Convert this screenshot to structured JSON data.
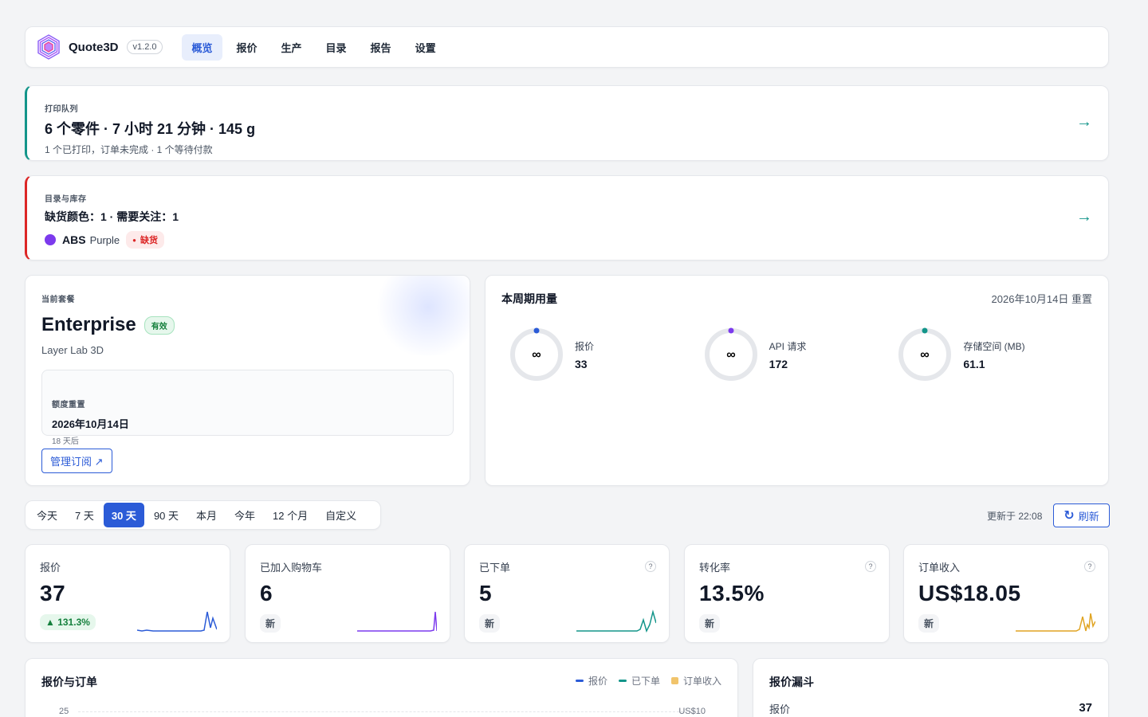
{
  "colors": {
    "accent": "#2b5bd7",
    "teal": "#13958a",
    "danger": "#dc2626",
    "purple": "#7c3aed",
    "gold": "#e0a422"
  },
  "nav": {
    "brand": "Quote3D",
    "version": "v1.2.0",
    "tabs": [
      "概览",
      "报价",
      "生产",
      "目录",
      "报告",
      "设置"
    ],
    "active_tab": "概览"
  },
  "queue": {
    "eyebrow": "打印队列",
    "headline": "6 个零件 · 7 小时 21 分钟 · 145 g",
    "sub": "1 个已打印，订单未完成 · 1 个等待付款",
    "arrow": "→"
  },
  "inventory": {
    "eyebrow": "目录与库存",
    "headline": "缺货颜色：1 · 需要关注：1",
    "material": "ABS",
    "color": "Purple",
    "status": "缺货",
    "arrow": "→"
  },
  "plan": {
    "eyebrow": "当前套餐",
    "name": "Enterprise",
    "badge": "有效",
    "org": "Layer Lab 3D",
    "reset_label": "额度重置",
    "reset_date": "2026年10月14日",
    "reset_days": "18 天后",
    "manage": "管理订阅 ↗"
  },
  "usage": {
    "title": "本周期用量",
    "reset_note": "2026年10月14日 重置",
    "meters": [
      {
        "label": "报价",
        "value": "33",
        "limit": "∞",
        "color": "#2b5bd7"
      },
      {
        "label": "API 请求",
        "value": "172",
        "limit": "∞",
        "color": "#7c3aed"
      },
      {
        "label": "存储空间 (MB)",
        "value": "61.1",
        "limit": "∞",
        "color": "#13958a"
      }
    ]
  },
  "ranges": {
    "items": [
      "今天",
      "7 天",
      "30 天",
      "90 天",
      "本月",
      "今年",
      "12 个月",
      "自定义"
    ],
    "active": "30 天",
    "updated": "更新于 22:08",
    "refresh": "刷新"
  },
  "kpis": [
    {
      "label": "报价",
      "value": "37",
      "tag": "▲ 131.3%",
      "tag_up": true,
      "help": "",
      "color": "#2b5bd7"
    },
    {
      "label": "已加入购物车",
      "value": "6",
      "tag": "新",
      "tag_up": false,
      "help": "",
      "color": "#7c3aed"
    },
    {
      "label": "已下单",
      "value": "5",
      "tag": "新",
      "tag_up": false,
      "help": "?",
      "color": "#13958a"
    },
    {
      "label": "转化率",
      "value": "13.5%",
      "tag": "新",
      "tag_up": false,
      "help": "?",
      "color": "#13958a"
    },
    {
      "label": "订单收入",
      "value": "US$18.05",
      "tag": "新",
      "tag_up": false,
      "help": "?",
      "color": "#e0a422"
    }
  ],
  "quotes_orders": {
    "title": "报价与订单",
    "legend": [
      "报价",
      "已下单",
      "订单收入"
    ],
    "y_left_top": "25",
    "y_right_top": "US$10"
  },
  "funnel": {
    "title": "报价漏斗",
    "rows": [
      {
        "label": "报价",
        "value": "37"
      }
    ]
  }
}
